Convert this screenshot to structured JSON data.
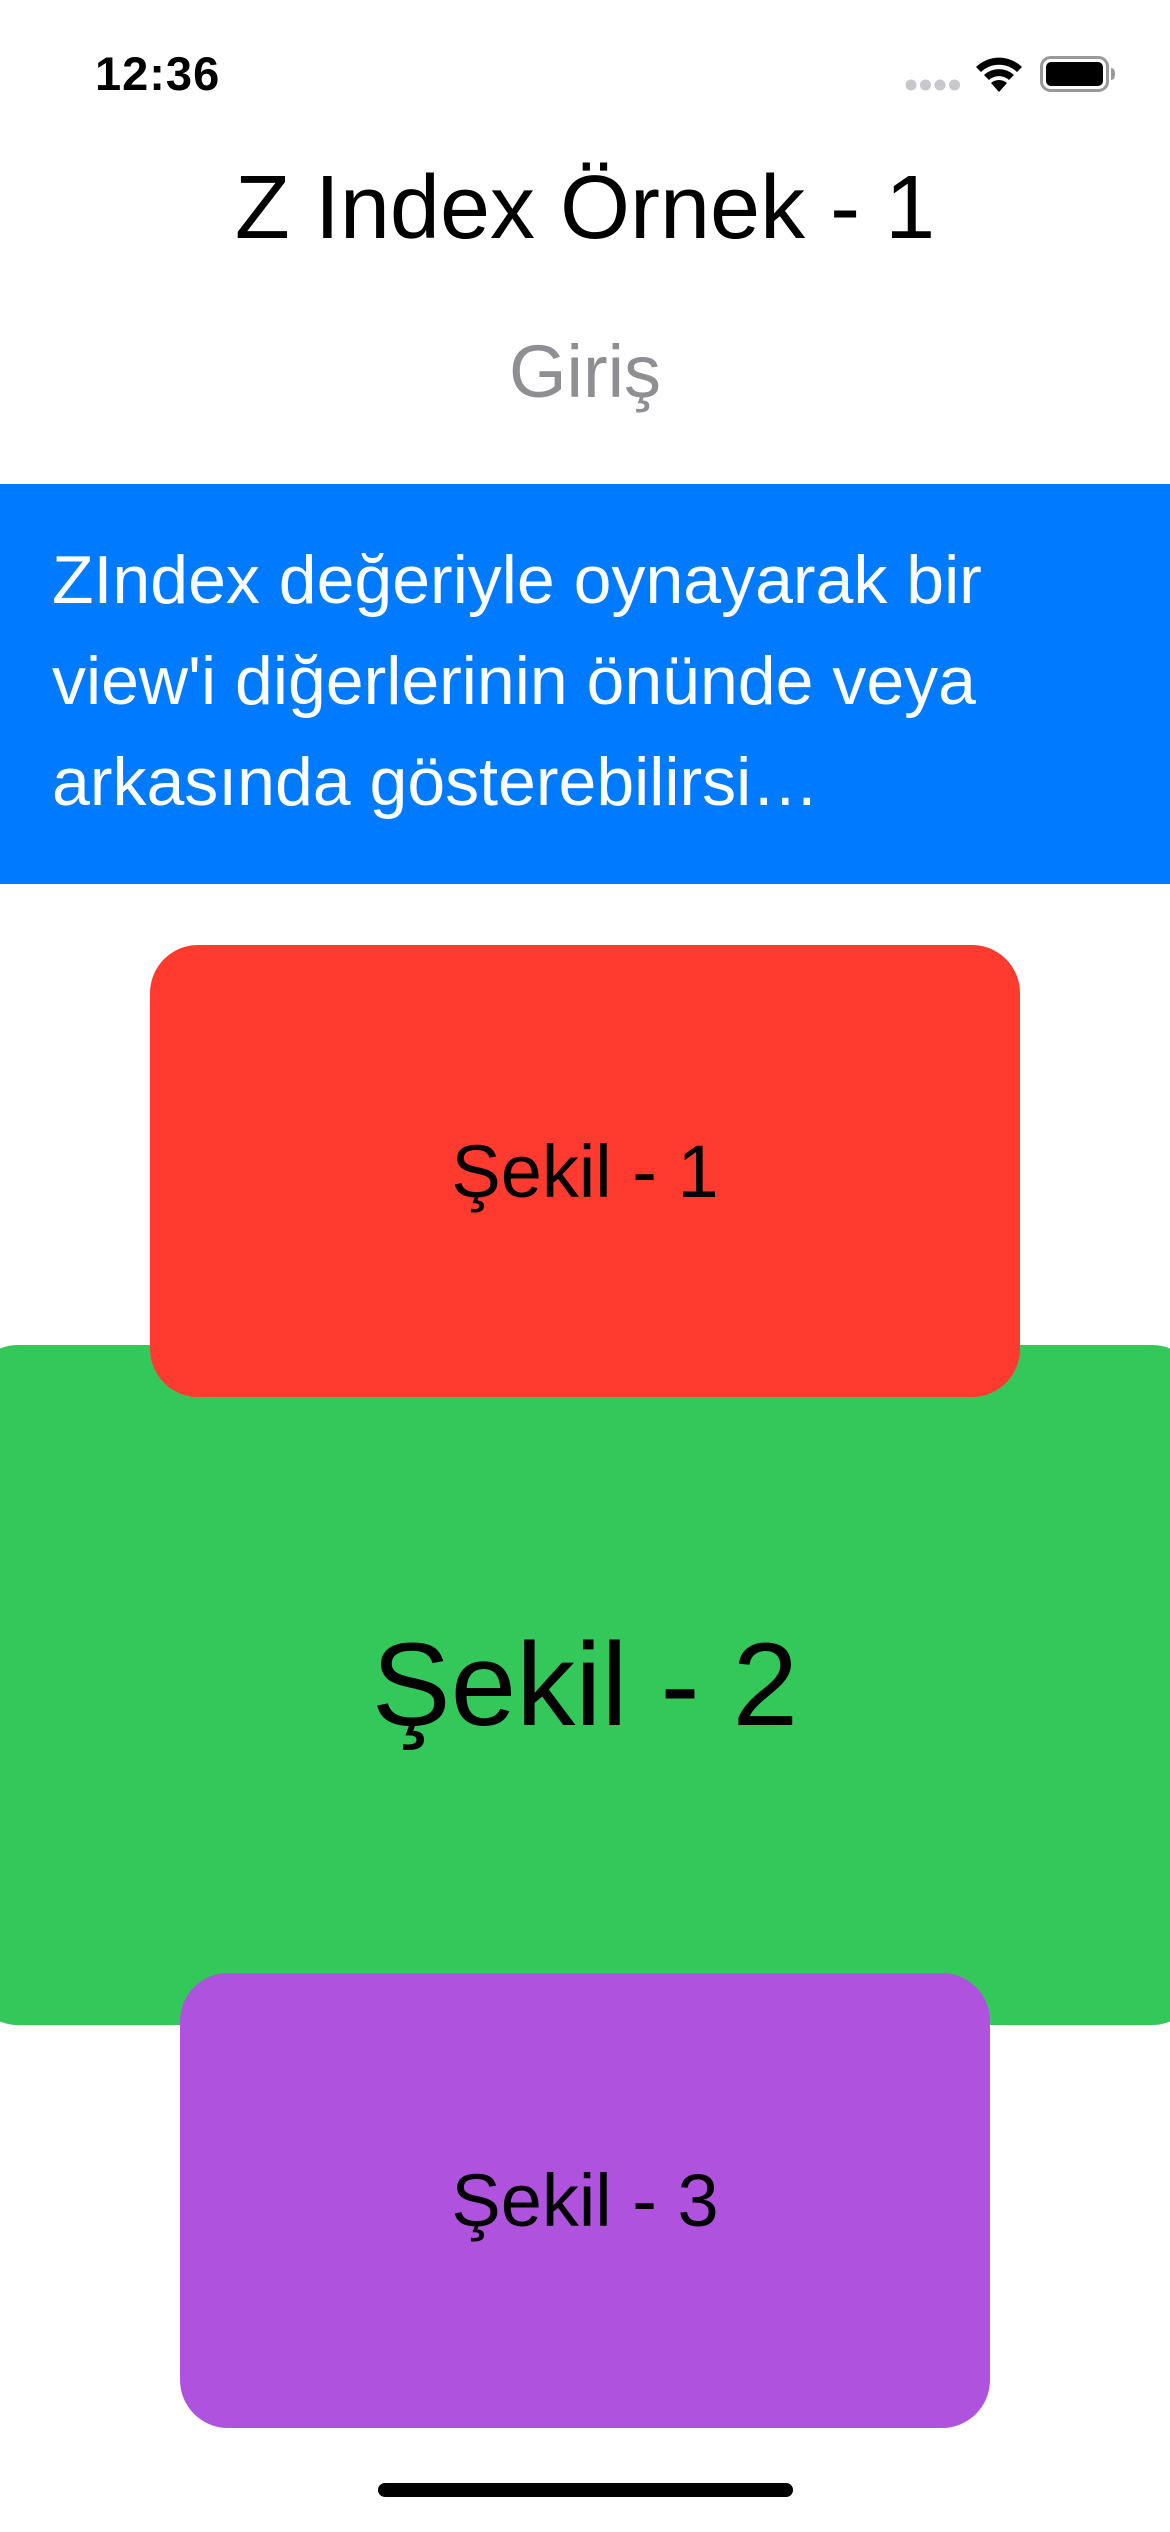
{
  "status_bar": {
    "time": "12:36",
    "icons": [
      "cellular-signal-icon",
      "wifi-icon",
      "battery-icon"
    ]
  },
  "header": {
    "title": "Z Index Örnek - 1",
    "subtitle": "Giriş"
  },
  "description": {
    "text": "ZIndex değeriyle oynayarak bir view'i diğerlerinin önünde veya arkasında gösterebilirsi…",
    "background_color": "#007aff",
    "text_color": "#ffffff"
  },
  "shapes": [
    {
      "label": "Şekil - 1",
      "color": "#ff3b30"
    },
    {
      "label": "Şekil - 2",
      "color": "#34c759"
    },
    {
      "label": "Şekil - 3",
      "color": "#af52de"
    }
  ]
}
